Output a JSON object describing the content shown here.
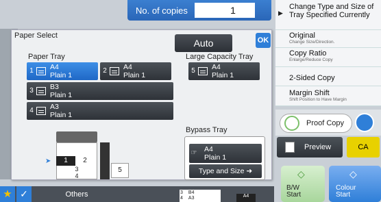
{
  "copies": {
    "label": "No. of copies",
    "value": "1"
  },
  "panel": {
    "title": "Paper Select",
    "auto_label": "Auto",
    "ok_label": "OK",
    "paper_tray_label": "Paper Tray",
    "large_capacity_label": "Large Capacity Tray",
    "bypass_label": "Bypass Tray",
    "trays": [
      {
        "num": "1",
        "size": "A4",
        "type": "Plain 1",
        "selected": true
      },
      {
        "num": "2",
        "size": "A4",
        "type": "Plain 1",
        "selected": false
      },
      {
        "num": "3",
        "size": "B3",
        "type": "Plain 1",
        "selected": false
      },
      {
        "num": "4",
        "size": "A3",
        "type": "Plain 1",
        "selected": false
      }
    ],
    "lct": {
      "num": "5",
      "size": "A4",
      "type": "Plain 1"
    },
    "bypass": {
      "size": "A4",
      "type": "Plain 1",
      "type_size_label": "Type and Size"
    },
    "diagram_numbers": [
      "1",
      "2",
      "3",
      "4",
      "5"
    ]
  },
  "right_menu": [
    {
      "main": "Change Type and Size of Tray Specified Currently",
      "sub": ""
    },
    {
      "main": "Original",
      "sub": "Change Size/Direction."
    },
    {
      "main": "Copy Ratio",
      "sub": "Enlarge/Reduce Copy"
    },
    {
      "main": "2-Sided Copy",
      "sub": ""
    },
    {
      "main": "Margin Shift",
      "sub": "Shift Position to Have Margin"
    }
  ],
  "proof_copy_label": "Proof Copy",
  "preview_label": "Preview",
  "ca_label": "CA",
  "bw_start": {
    "line1": "B/W",
    "line2": "Start"
  },
  "colour_start": {
    "line1": "Colour",
    "line2": "Start"
  },
  "bottom": {
    "others_label": "Others"
  },
  "mini_status": {
    "rows": [
      [
        "3",
        "B4"
      ],
      [
        "4",
        "A3"
      ]
    ],
    "current": "A4"
  },
  "colors": {
    "accent": "#2f7fd8",
    "ca": "#e8d100",
    "bw_green": "#a8d69c"
  }
}
